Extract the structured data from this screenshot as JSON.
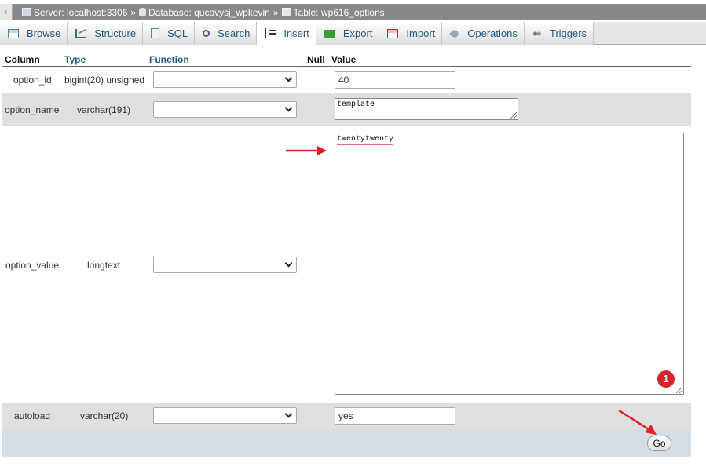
{
  "breadcrumb": {
    "collapse_glyph": "‹",
    "server": "Server: localhost:3306",
    "database": "Database: qucovysj_wpkevin",
    "table": "Table: wp616_options",
    "separator": "»"
  },
  "tabs": [
    {
      "label": "Browse",
      "icon": "browse-icon"
    },
    {
      "label": "Structure",
      "icon": "structure-icon"
    },
    {
      "label": "SQL",
      "icon": "sql-icon"
    },
    {
      "label": "Search",
      "icon": "search-icon"
    },
    {
      "label": "Insert",
      "icon": "insert-icon",
      "active": true
    },
    {
      "label": "Export",
      "icon": "export-icon"
    },
    {
      "label": "Import",
      "icon": "import-icon"
    },
    {
      "label": "Operations",
      "icon": "operations-icon"
    },
    {
      "label": "Triggers",
      "icon": "triggers-icon"
    }
  ],
  "grid": {
    "headers": {
      "column": "Column",
      "type": "Type",
      "function": "Function",
      "null": "Null",
      "value": "Value"
    },
    "rows": [
      {
        "column": "option_id",
        "type": "bigint(20) unsigned",
        "function": "",
        "value": "40"
      },
      {
        "column": "option_name",
        "type": "varchar(191)",
        "function": "",
        "value": "template"
      },
      {
        "column": "option_value",
        "type": "longtext",
        "function": "",
        "value": "twentytwenty"
      },
      {
        "column": "autoload",
        "type": "varchar(20)",
        "function": "",
        "value": "yes"
      }
    ]
  },
  "actions": {
    "go_label": "Go"
  },
  "annotation": {
    "badge": "1"
  },
  "colors": {
    "breadcrumb_bg": "#888888",
    "tab_text": "#235a81",
    "annotation_red": "#d8232a",
    "footer_bg": "#d5dde5"
  }
}
